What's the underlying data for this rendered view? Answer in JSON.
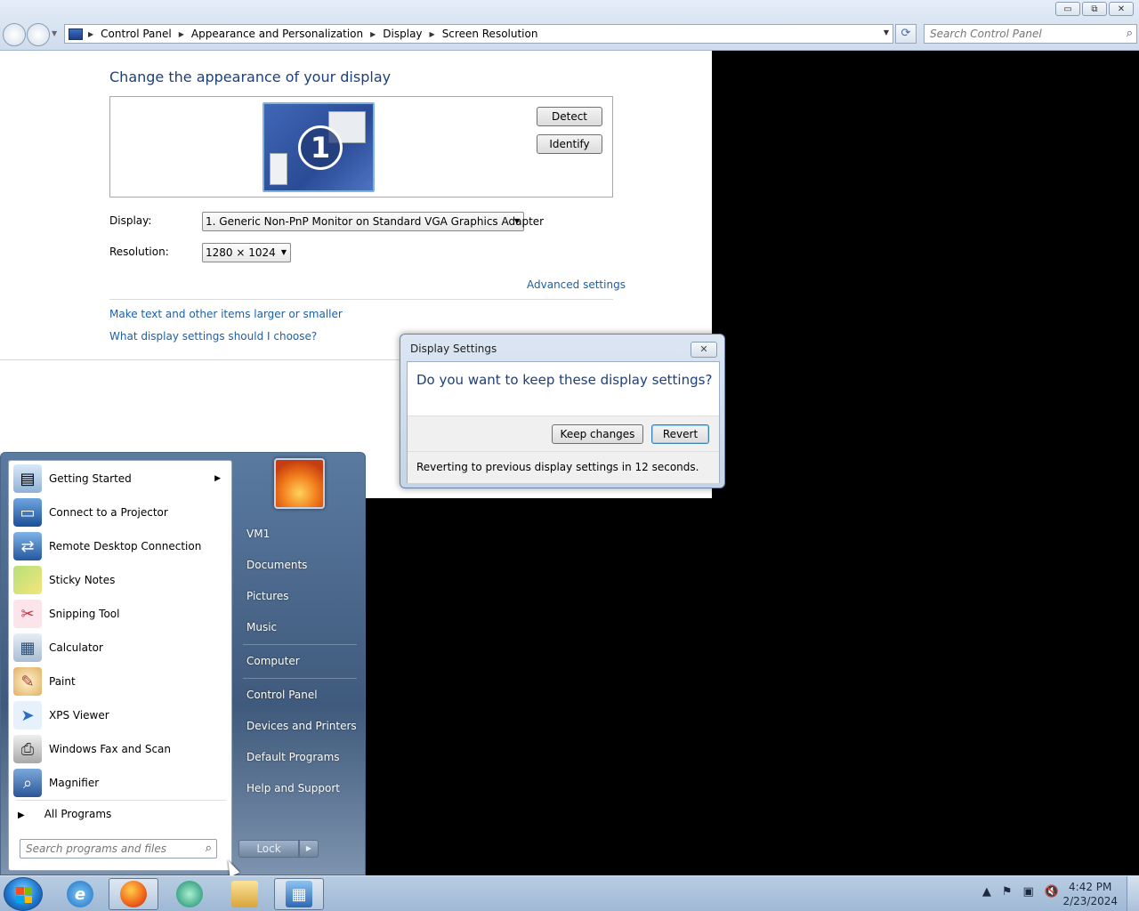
{
  "window": {
    "buttons": {
      "minimize": "▭",
      "restore": "⧉",
      "close": "✕"
    }
  },
  "address": {
    "breadcrumbs": [
      "Control Panel",
      "Appearance and Personalization",
      "Display",
      "Screen Resolution"
    ],
    "search_placeholder": "Search Control Panel"
  },
  "page": {
    "title": "Change the appearance of your display",
    "monitor_number": "1",
    "detect": "Detect",
    "identify": "Identify",
    "display_label": "Display:",
    "display_value": "1. Generic Non-PnP Monitor on Standard VGA Graphics Adapter",
    "resolution_label": "Resolution:",
    "resolution_value": "1280 × 1024",
    "advanced_link": "Advanced settings",
    "link_text_size": "Make text and other items larger or smaller",
    "link_help": "What display settings should I choose?"
  },
  "dialog": {
    "title": "Display Settings",
    "question": "Do you want to keep these display settings?",
    "keep": "Keep changes",
    "revert": "Revert",
    "status": "Reverting to previous display settings in 12 seconds."
  },
  "start_menu": {
    "programs": [
      {
        "label": "Getting Started",
        "icon": "getting-started-icon",
        "submenu": true
      },
      {
        "label": "Connect to a Projector",
        "icon": "projector-icon"
      },
      {
        "label": "Remote Desktop Connection",
        "icon": "remote-desktop-icon"
      },
      {
        "label": "Sticky Notes",
        "icon": "sticky-notes-icon"
      },
      {
        "label": "Snipping Tool",
        "icon": "snipping-tool-icon"
      },
      {
        "label": "Calculator",
        "icon": "calculator-icon"
      },
      {
        "label": "Paint",
        "icon": "paint-icon"
      },
      {
        "label": "XPS Viewer",
        "icon": "xps-viewer-icon"
      },
      {
        "label": "Windows Fax and Scan",
        "icon": "fax-scan-icon"
      },
      {
        "label": "Magnifier",
        "icon": "magnifier-icon"
      }
    ],
    "all_programs": "All Programs",
    "search_placeholder": "Search programs and files",
    "right_items": [
      "VM1",
      "Documents",
      "Pictures",
      "Music",
      "Computer",
      "Control Panel",
      "Devices and Printers",
      "Default Programs",
      "Help and Support"
    ],
    "lock": "Lock"
  },
  "taskbar": {
    "apps": [
      "internet-explorer-icon",
      "firefox-icon",
      "app-icon",
      "file-explorer-icon",
      "control-panel-icon"
    ],
    "time": "4:42 PM",
    "date": "2/23/2024"
  },
  "colors": {
    "title_blue": "#1e3f7a",
    "link_blue": "#1c5fa8",
    "desktop": "#000000"
  }
}
